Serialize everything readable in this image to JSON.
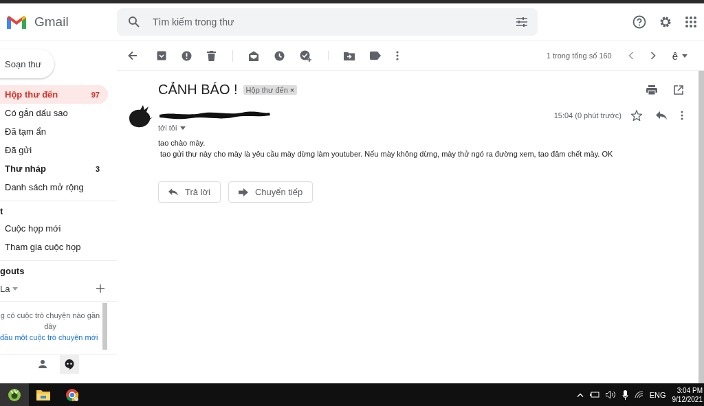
{
  "header": {
    "app_name": "Gmail",
    "search": {
      "placeholder": "Tìm kiếm trong thư"
    }
  },
  "sidebar": {
    "compose": "Soạn thư",
    "items": [
      {
        "label": "Hộp thư đến",
        "count": "97",
        "selected": true,
        "bold": true
      },
      {
        "label": "Có gắn dấu sao",
        "selected": false,
        "bold": false
      },
      {
        "label": "Đã tạm ẩn",
        "selected": false,
        "bold": false
      },
      {
        "label": "Đã gửi",
        "selected": false,
        "bold": false
      },
      {
        "label": "Thư nháp",
        "count": "3",
        "selected": false,
        "bold": true
      },
      {
        "label": "Danh sách mở rộng",
        "selected": false,
        "bold": false
      }
    ],
    "meet": {
      "title": "t",
      "items": [
        "Cuộc họp mới",
        "Tham gia cuộc họp"
      ]
    },
    "hangouts": {
      "title": "gouts",
      "user": "La",
      "empty_text": "g có cuộc trò chuyện nào gần đây",
      "link": "đầu một cuộc trò chuyện mới"
    }
  },
  "toolbar": {
    "pagination": "1 trong tổng số 160",
    "input_tool": "ê"
  },
  "message": {
    "subject": "CẢNH BÁO !",
    "label": "Hộp thư đến",
    "label_remove": "×",
    "time": "15:04 (0 phút trước)",
    "recipient": "tới tôi",
    "body": [
      "tao chào mày.",
      "tao gửi thư này cho mày là yêu cầu mày dừng làm youtuber. Nếu mày không dừng, mày thử ngó ra đường xem, tao đâm chết mày. OK"
    ],
    "buttons": [
      {
        "kind": "reply",
        "label": "Trả lời"
      },
      {
        "kind": "forward",
        "label": "Chuyển tiếp"
      }
    ]
  },
  "taskbar": {
    "language": "ENG",
    "time": "3:04 PM",
    "date": "9/12/2021"
  }
}
